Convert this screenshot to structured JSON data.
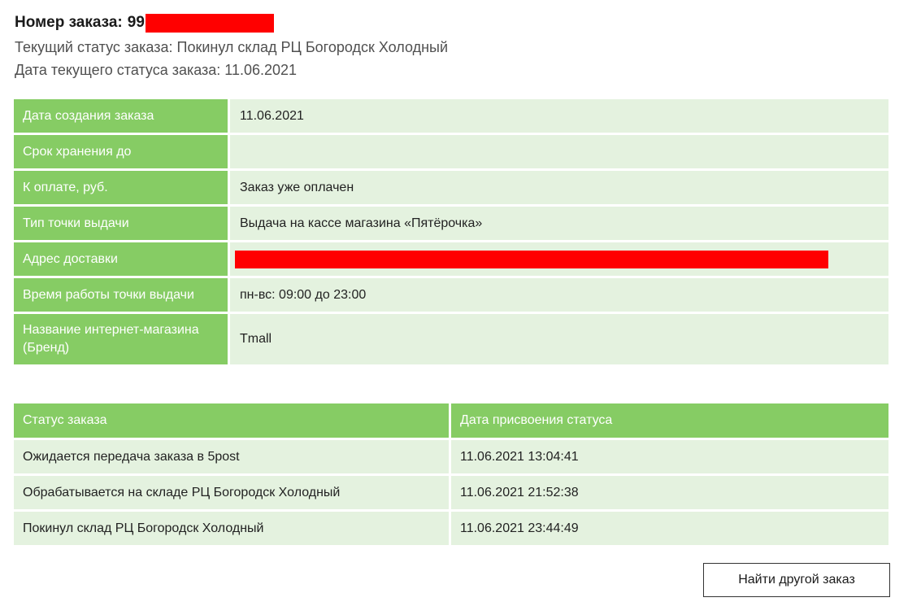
{
  "header": {
    "order_number_label": "Номер заказа:",
    "order_number_visible": "99",
    "current_status": "Текущий статус заказа: Покинул склад РЦ Богородск Холодный",
    "current_status_date": "Дата текущего статуса заказа: 11.06.2021"
  },
  "info": [
    {
      "key": "Дата создания заказа",
      "value": "11.06.2021"
    },
    {
      "key": "Срок хранения до",
      "value": ""
    },
    {
      "key": "К оплате, руб.",
      "value": "Заказ уже оплачен"
    },
    {
      "key": "Тип точки выдачи",
      "value": "Выдача на кассе магазина «Пятёрочка»"
    },
    {
      "key": "Адрес доставки",
      "value": ""
    },
    {
      "key": "Время работы точки выдачи",
      "value": "пн-вс: 09:00 до 23:00"
    },
    {
      "key": "Название интернет-магазина (Бренд)",
      "value": "Tmall"
    }
  ],
  "history": {
    "columns": [
      "Статус заказа",
      "Дата присвоения статуса"
    ],
    "rows": [
      [
        "Ожидается передача заказа в 5post",
        "11.06.2021 13:04:41"
      ],
      [
        "Обрабатывается на складе РЦ Богородск Холодный",
        "11.06.2021 21:52:38"
      ],
      [
        "Покинул склад РЦ Богородск Холодный",
        "11.06.2021 23:44:49"
      ]
    ]
  },
  "actions": {
    "find_another_label": "Найти другой заказ"
  },
  "colors": {
    "header_green": "#86cc64",
    "cell_light_green": "#e4f2df",
    "redaction": "#ff0000"
  }
}
